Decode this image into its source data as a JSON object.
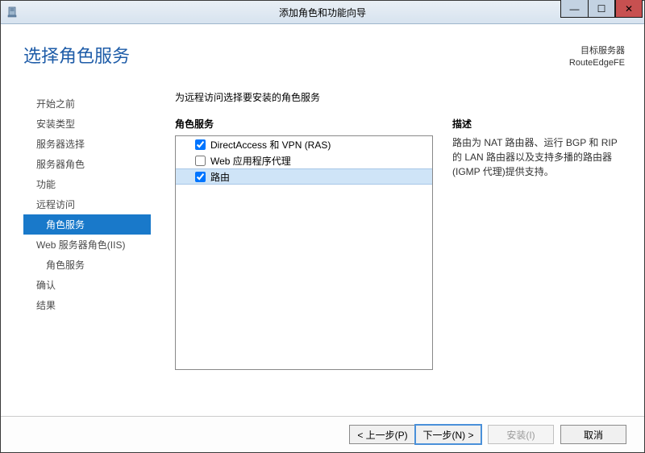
{
  "window": {
    "title": "添加角色和功能向导"
  },
  "header": {
    "page_title": "选择角色服务",
    "target_label": "目标服务器",
    "target_name": "RouteEdgeFE"
  },
  "sidebar": {
    "items": [
      {
        "label": "开始之前",
        "selected": false,
        "indent": false
      },
      {
        "label": "安装类型",
        "selected": false,
        "indent": false
      },
      {
        "label": "服务器选择",
        "selected": false,
        "indent": false
      },
      {
        "label": "服务器角色",
        "selected": false,
        "indent": false
      },
      {
        "label": "功能",
        "selected": false,
        "indent": false
      },
      {
        "label": "远程访问",
        "selected": false,
        "indent": false
      },
      {
        "label": "角色服务",
        "selected": true,
        "indent": true
      },
      {
        "label": "Web 服务器角色(IIS)",
        "selected": false,
        "indent": false
      },
      {
        "label": "角色服务",
        "selected": false,
        "indent": true
      },
      {
        "label": "确认",
        "selected": false,
        "indent": false
      },
      {
        "label": "结果",
        "selected": false,
        "indent": false
      }
    ]
  },
  "main": {
    "instruction": "为远程访问选择要安装的角色服务",
    "roles_header": "角色服务",
    "desc_header": "描述",
    "roles": [
      {
        "label": "DirectAccess 和 VPN (RAS)",
        "checked": true,
        "selected": false
      },
      {
        "label": "Web 应用程序代理",
        "checked": false,
        "selected": false
      },
      {
        "label": "路由",
        "checked": true,
        "selected": true
      }
    ],
    "description": "路由为 NAT 路由器、运行 BGP 和 RIP 的 LAN 路由器以及支持多播的路由器(IGMP 代理)提供支持。"
  },
  "footer": {
    "prev": "< 上一步(P)",
    "next": "下一步(N) >",
    "install": "安装(I)",
    "cancel": "取消"
  }
}
